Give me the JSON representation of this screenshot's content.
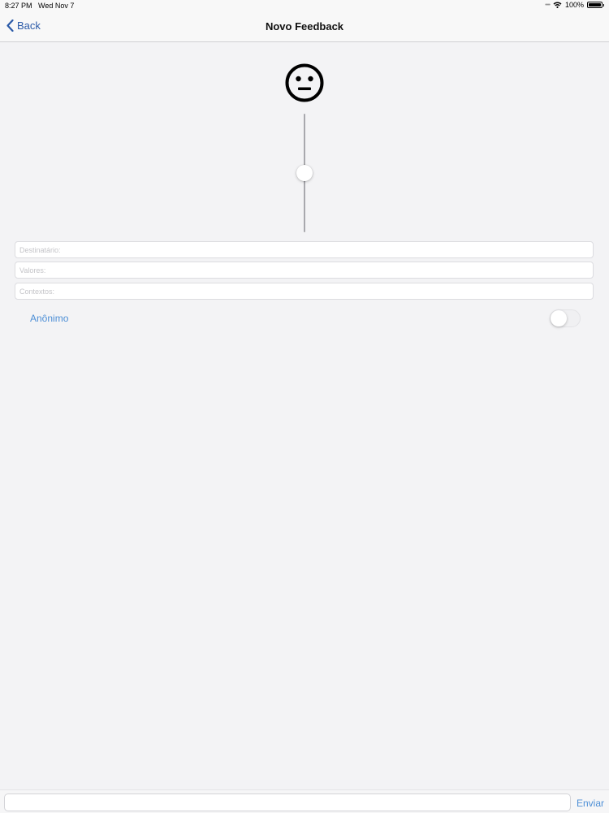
{
  "status_bar": {
    "time": "8:27 PM",
    "date": "Wed Nov 7",
    "signal_icon": "signal-dots",
    "wifi_icon": "wifi-icon",
    "battery": "100%",
    "battery_level": 1.0
  },
  "nav": {
    "back_label": "Back",
    "back_icon": "chevron-left-icon",
    "title": "Novo Feedback",
    "accent": "#2b5aa8"
  },
  "feedback": {
    "mood_icon": "neutral-face-icon",
    "slider_level": 0.5
  },
  "form": {
    "recipient_placeholder": "Destinatário:",
    "values_placeholder": "Valores:",
    "contexts_placeholder": "Contextos:",
    "anonymous_label": "Anônimo",
    "anonymous_on": false
  },
  "compose": {
    "input_value": "",
    "send_label": "Enviar",
    "accent": "#4d8fd6"
  }
}
